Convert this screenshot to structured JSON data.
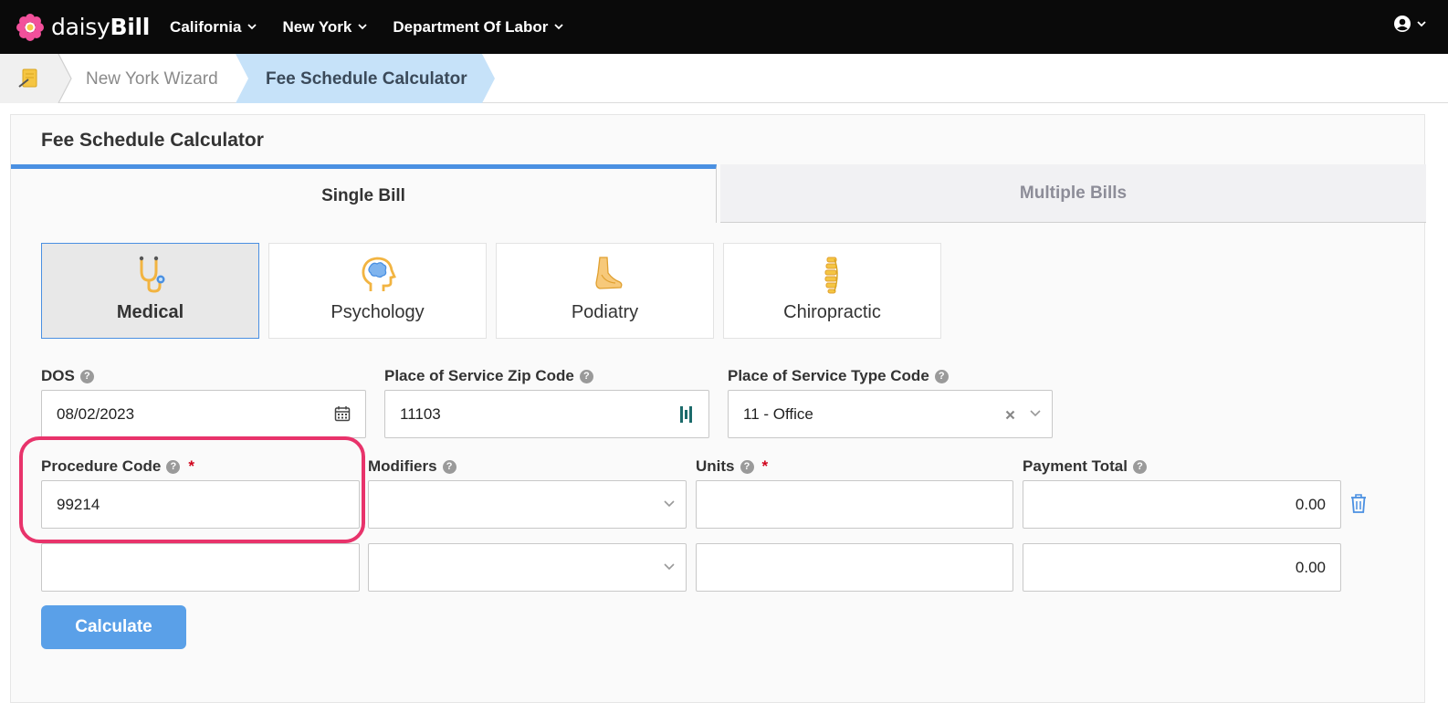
{
  "app": {
    "logo_text_light": "daisy",
    "logo_text_bold": "Bill"
  },
  "nav": {
    "items": [
      {
        "label": "California"
      },
      {
        "label": "New York"
      },
      {
        "label": "Department Of Labor"
      }
    ]
  },
  "breadcrumb": {
    "items": [
      {
        "label": "New York Wizard"
      },
      {
        "label": "Fee Schedule Calculator"
      }
    ]
  },
  "page": {
    "title": "Fee Schedule Calculator"
  },
  "tabs": [
    {
      "label": "Single Bill",
      "active": true
    },
    {
      "label": "Multiple Bills",
      "active": false
    }
  ],
  "bill_types": [
    {
      "label": "Medical",
      "icon": "stethoscope-icon",
      "selected": true
    },
    {
      "label": "Psychology",
      "icon": "brain-head-icon",
      "selected": false
    },
    {
      "label": "Podiatry",
      "icon": "foot-icon",
      "selected": false
    },
    {
      "label": "Chiropractic",
      "icon": "spine-icon",
      "selected": false
    }
  ],
  "form": {
    "dos": {
      "label": "DOS",
      "value": "08/02/2023"
    },
    "zip": {
      "label": "Place of Service Zip Code",
      "value": "11103"
    },
    "pos_type": {
      "label": "Place of Service Type Code",
      "value": "11 - Office"
    },
    "columns": {
      "procedure": "Procedure Code",
      "modifiers": "Modifiers",
      "units": "Units",
      "payment_total": "Payment Total"
    },
    "rows": [
      {
        "procedure_code": "99214",
        "modifiers": "",
        "units": "",
        "payment_total": "0.00"
      },
      {
        "procedure_code": "",
        "modifiers": "",
        "units": "",
        "payment_total": "0.00"
      }
    ],
    "required_mark": "*",
    "help_glyph": "?"
  },
  "actions": {
    "calculate_label": "Calculate"
  },
  "colors": {
    "accent": "#4a90e2",
    "highlight": "#e8336b",
    "button": "#5aa0e8",
    "required": "#d0021b"
  }
}
